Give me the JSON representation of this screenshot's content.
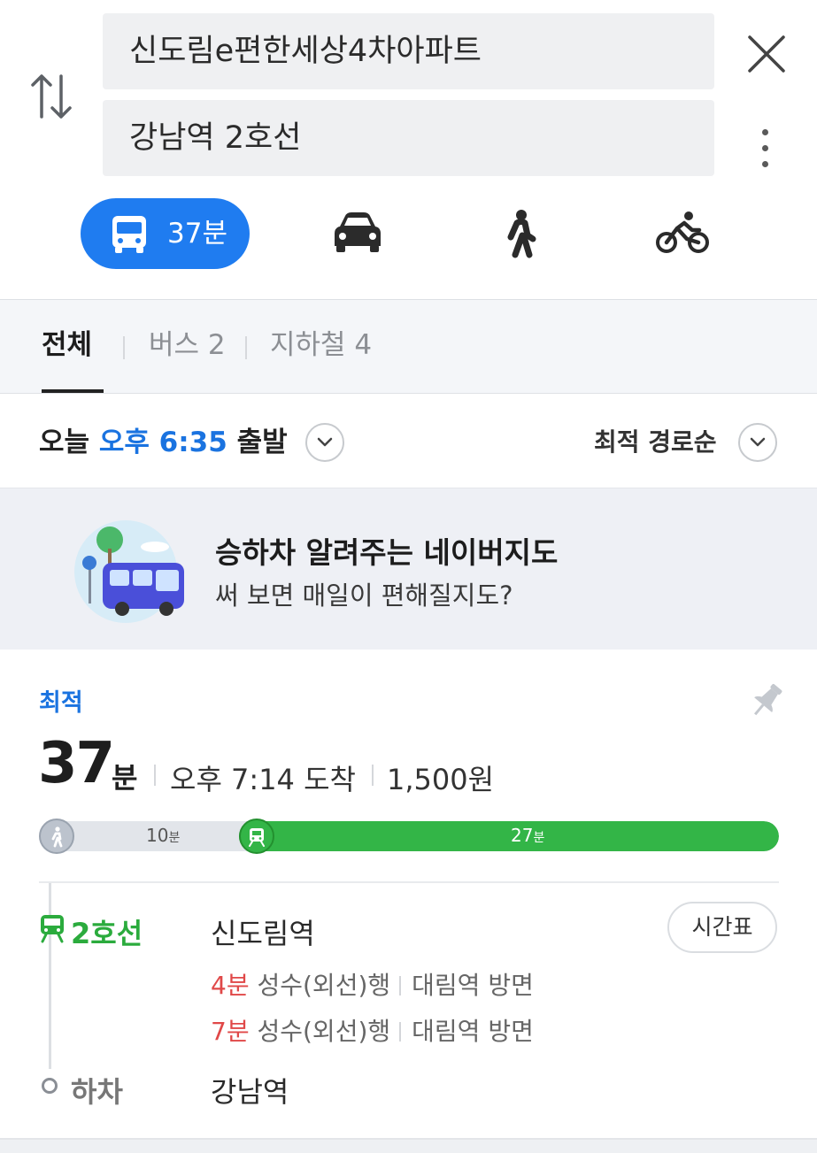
{
  "search": {
    "origin": "신도림e편한세상4차아파트",
    "destination": "강남역 2호선"
  },
  "modes": {
    "bus_label": "37분",
    "items": [
      "bus-mode",
      "car-mode",
      "walk-mode",
      "bike-mode"
    ],
    "active_color": "#1f7cf0"
  },
  "tabs": [
    {
      "label": "전체"
    },
    {
      "label": "버스 2"
    },
    {
      "label": "지하철 4"
    }
  ],
  "departure": {
    "prefix": "오늘",
    "time": "오후 6:35",
    "suffix": "출발",
    "sort_label": "최적 경로순"
  },
  "banner": {
    "title": "승하차 알려주는 네이버지도",
    "subtitle": "써 보면 매일이 편해질지도?"
  },
  "route": {
    "badge": "최적",
    "duration_value": "37",
    "duration_unit": "분",
    "arrival": "오후 7:14 도착",
    "fare": "1,500원",
    "segments": [
      {
        "type": "walk",
        "minutes_value": "10",
        "minutes_unit": "분"
      },
      {
        "type": "subway",
        "minutes_value": "27",
        "minutes_unit": "분"
      }
    ],
    "walk_fraction": 0.27,
    "line_name": "2호선",
    "board_station": "신도림역",
    "timetable_label": "시간표",
    "arrivals": [
      {
        "mins": "4분",
        "dest": "성수(외선)행",
        "direction": "대림역 방면"
      },
      {
        "mins": "7분",
        "dest": "성수(외선)행",
        "direction": "대림역 방면"
      }
    ],
    "alight_label": "하차",
    "alight_station": "강남역",
    "line_color": "#2bab3d"
  }
}
